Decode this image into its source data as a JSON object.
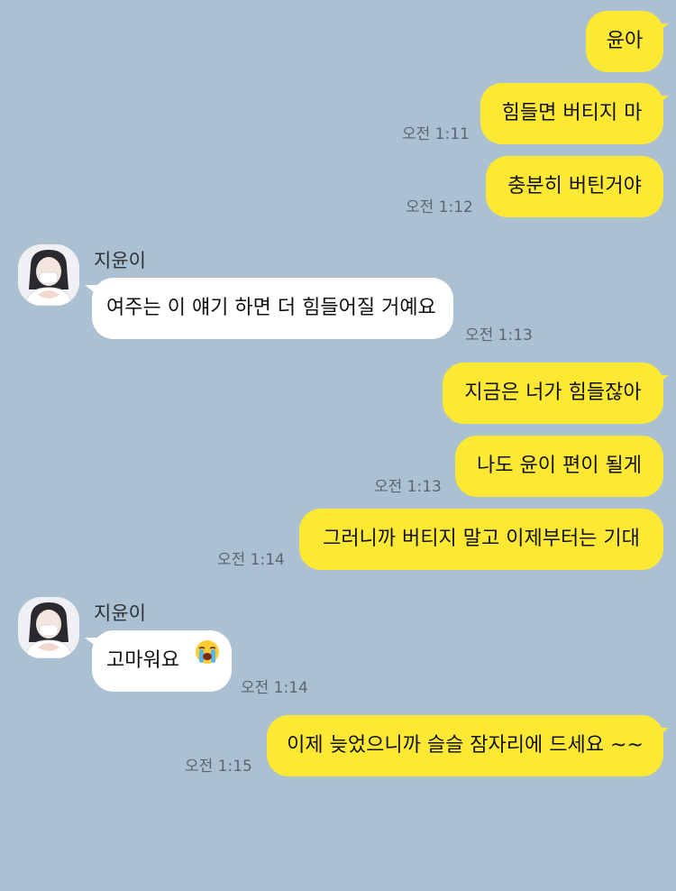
{
  "messages": [
    {
      "sender": "me",
      "text": "윤아",
      "time": ""
    },
    {
      "sender": "me",
      "text": "힘들면 버티지 마",
      "time": "오전 1:11"
    },
    {
      "sender": "me",
      "text": "충분히 버틴거야",
      "time": "오전 1:12"
    },
    {
      "sender": "them",
      "name": "지윤이",
      "text": "여주는 이 얘기 하면 더 힘들어질 거예요",
      "time": "오전 1:13"
    },
    {
      "sender": "me",
      "text": "지금은 너가 힘들잖아",
      "time": ""
    },
    {
      "sender": "me",
      "text": "나도 윤이 편이 될게",
      "time": "오전 1:13"
    },
    {
      "sender": "me",
      "text": "그러니까 버티지 말고 이제부터는 기대",
      "time": "오전 1:14"
    },
    {
      "sender": "them",
      "name": "지윤이",
      "text": "고마워요",
      "emoji": "loudly-crying-face-emoji",
      "time": "오전 1:14"
    },
    {
      "sender": "me",
      "text": "이제 늦었으니까 슬슬 잠자리에 드세요 ~~",
      "time": "오전 1:15"
    }
  ],
  "colors": {
    "background": "#abc1d1",
    "my_bubble": "#fde934",
    "their_bubble": "#ffffff"
  }
}
